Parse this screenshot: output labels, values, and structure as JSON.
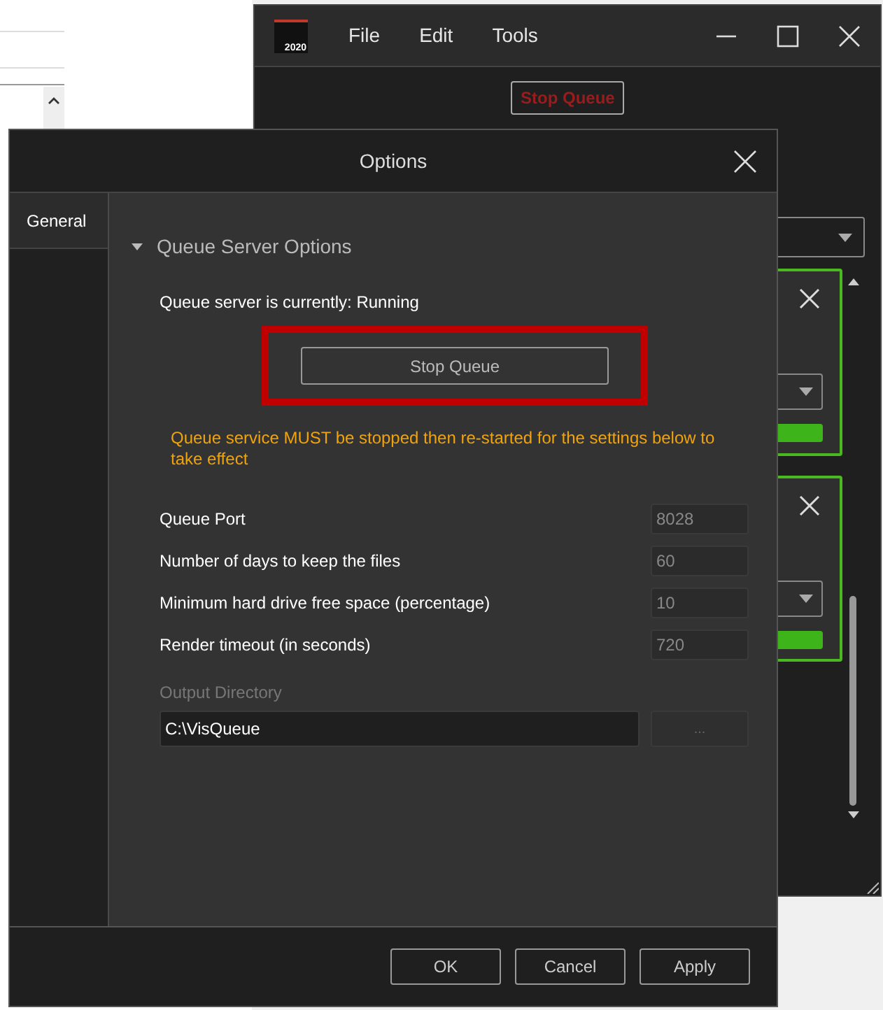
{
  "app_window": {
    "logo_year": "2020",
    "menu": [
      "File",
      "Edit",
      "Tools"
    ],
    "stop_button": "Stop Queue",
    "jobs": [
      {
        "level": 1
      },
      {
        "level": 1
      }
    ]
  },
  "dialog": {
    "title": "Options",
    "tabs": [
      {
        "label": "General",
        "selected": true
      }
    ],
    "section": {
      "title": "Queue Server Options",
      "expanded": true,
      "status": "Queue server is currently: Running",
      "stop_button": "Stop Queue",
      "highlighted": true,
      "warning": "Queue service MUST be stopped then re-started for the settings below to take effect",
      "fields": [
        {
          "label": "Queue Port",
          "value": "8028",
          "disabled": true
        },
        {
          "label": "Number of days to keep the files",
          "value": "60",
          "disabled": true
        },
        {
          "label": "Minimum hard drive free space (percentage)",
          "value": "10",
          "disabled": true
        },
        {
          "label": "Render timeout (in seconds)",
          "value": "720",
          "disabled": true
        }
      ],
      "output_directory": {
        "label": "Output Directory",
        "value": "C:\\VisQueue",
        "browse": "...",
        "disabled": true
      }
    },
    "buttons": [
      "OK",
      "Cancel",
      "Apply"
    ]
  }
}
